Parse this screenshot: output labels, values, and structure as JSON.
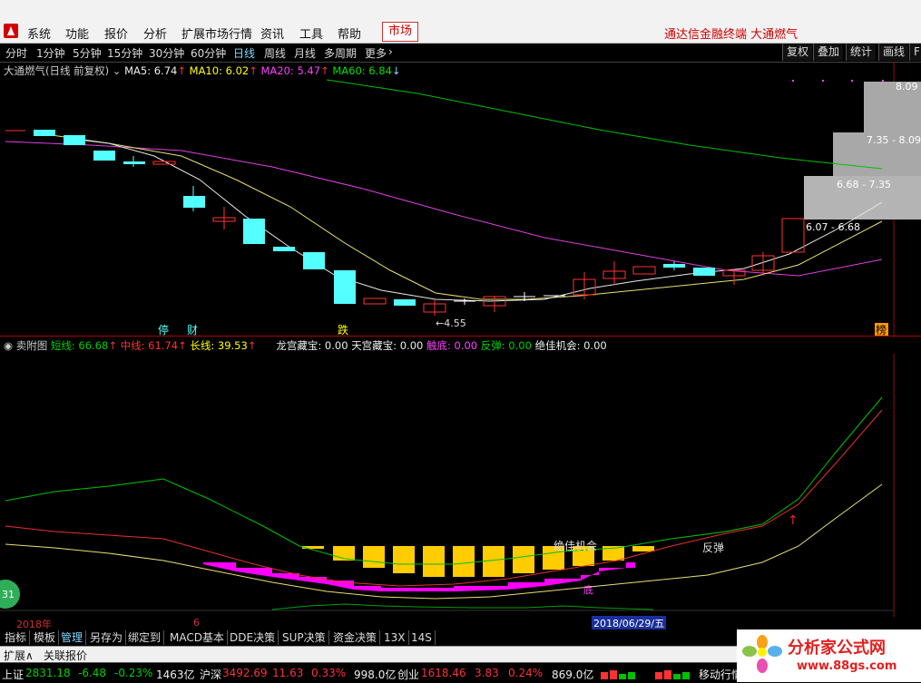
{
  "menu": {
    "items": [
      "系统",
      "功能",
      "报价",
      "分析",
      "扩展市场行情",
      "资讯",
      "工具",
      "帮助"
    ],
    "market": "市场",
    "right_title": "通达信金融终端  大通燃气"
  },
  "toolbar": {
    "items": [
      "分时",
      "1分钟",
      "5分钟",
      "15分钟",
      "30分钟",
      "60分钟",
      "日线",
      "周线",
      "月线",
      "多周期",
      "更多"
    ],
    "active": "日线",
    "right": [
      "复权",
      "叠加",
      "统计",
      "画线",
      "F"
    ]
  },
  "main_legend": {
    "title": "大通燃气(日线 前复权)",
    "ma5": "MA5: 6.74",
    "ma10": "MA10: 6.02",
    "ma20": "MA20: 5.47",
    "ma60": "MA60: 6.84"
  },
  "price_labels": {
    "low": "4.55",
    "r1": "8.09",
    "r2": "7.35 - 8.09",
    "r3": "6.68 - 7.35",
    "r4": "6.07 - 6.68"
  },
  "event_marks": [
    "停",
    "财",
    "跌",
    "榜"
  ],
  "sub_legend": {
    "title": "卖附图",
    "short": "短线: 66.68",
    "mid": "中线: 61.74",
    "long": "长线: 39.53",
    "l1": "龙宫藏宝: 0.00",
    "l2": "天宫藏宝: 0.00",
    "l3": "触底: 0.00",
    "l4": "反弹: 0.00",
    "l5": "绝佳机会: 0.00"
  },
  "sub_annotations": {
    "a": "绝佳机会",
    "b": "反弹",
    "c": "底"
  },
  "date_axis": {
    "year": "2018年",
    "month": "6",
    "cursor": "2018/06/29/五"
  },
  "bottom_tabs": [
    "指标",
    "模板",
    "管理",
    "另存为",
    "绑定到",
    "MACD基本",
    "DDE决策",
    "SUP决策",
    "资金决策",
    "13X",
    "14S"
  ],
  "ext": {
    "left": "扩展∧",
    "right": "关联报价"
  },
  "status": {
    "sh_label": "上证",
    "sh_val": "2831.18",
    "sh_chg": "-6.48",
    "sh_pct": "-0.23%",
    "sh_vol": "1463亿",
    "sz_label": "沪深",
    "sz_val": "3492.69",
    "sz_chg": "11.63",
    "sz_pct": "0.33%",
    "sz_vol": "998.0亿",
    "cy_label": "创业",
    "cy_val": "1618.46",
    "cy_chg": "3.83",
    "cy_pct": "0.24%",
    "cy_vol": "869.0亿",
    "right": "移动行情主站"
  },
  "watermark": {
    "text": "分析家公式网",
    "url": "www.88gs.com"
  },
  "badge": "31"
}
